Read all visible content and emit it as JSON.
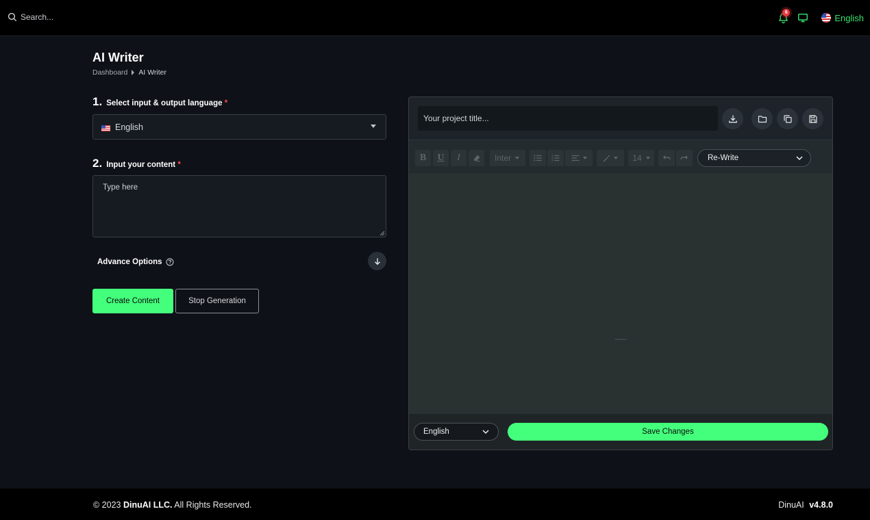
{
  "topbar": {
    "search_placeholder": "Search...",
    "notification_count": "6",
    "language": "English",
    "icons": [
      "search-icon",
      "bell-icon",
      "monitor-icon",
      "us-flag-icon"
    ],
    "accent": "#39e16b"
  },
  "header": {
    "title": "AI Writer",
    "breadcrumb": [
      "Dashboard",
      "AI Writer"
    ]
  },
  "form": {
    "step1": {
      "number": "1.",
      "label": "Select input & output language",
      "required": "*"
    },
    "language_value": "English",
    "step2": {
      "number": "2.",
      "label": "Input your content",
      "required": "*"
    },
    "content_placeholder": "Type here",
    "advance_options": "Advance Options",
    "create_button": "Create Content",
    "stop_button": "Stop Generation"
  },
  "editor": {
    "title_placeholder": "Your project title...",
    "font_family": "Inter",
    "font_size": "14",
    "rewrite_option": "Re-Write",
    "footer_language": "English",
    "save_button": "Save Changes"
  },
  "footer": {
    "year": "© 2023",
    "company": "DinuAI LLC.",
    "rights": "All Rights Reserved.",
    "brand": "DinuAI",
    "version": "v4.8.0"
  },
  "colors": {
    "primary_button": "#44ff7c",
    "background": "#0e1117",
    "required_star": "#ff4d4f"
  }
}
